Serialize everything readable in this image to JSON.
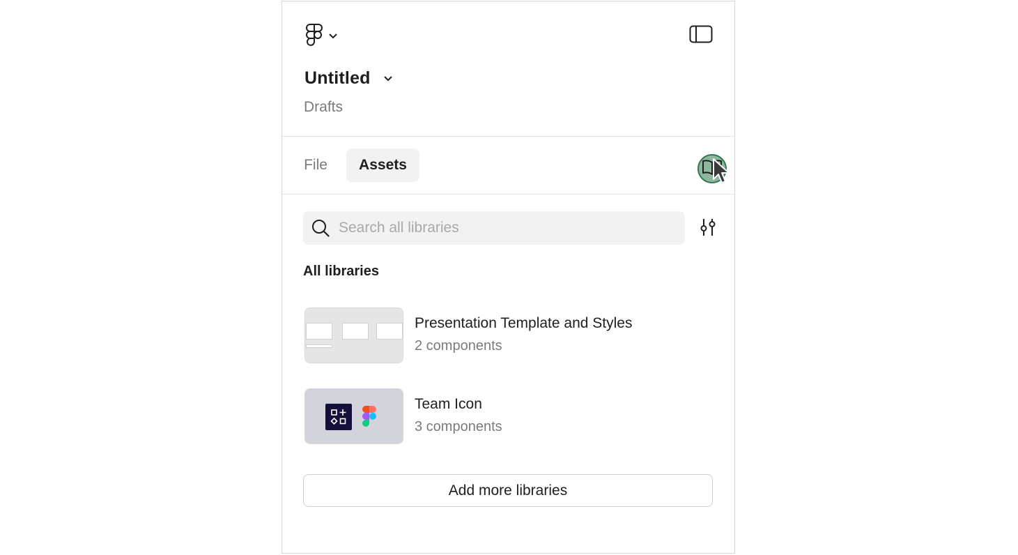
{
  "header": {
    "file_title": "Untitled",
    "file_location": "Drafts"
  },
  "tabs": [
    {
      "label": "File",
      "active": false
    },
    {
      "label": "Assets",
      "active": true
    }
  ],
  "search": {
    "placeholder": "Search all libraries",
    "value": ""
  },
  "libraries": {
    "heading": "All libraries",
    "items": [
      {
        "name": "Presentation Template and Styles",
        "count": "2 components"
      },
      {
        "name": "Team Icon",
        "count": "3 components"
      }
    ],
    "add_label": "Add more libraries"
  },
  "icons": {
    "main_menu": "figma-logo-icon",
    "sidebar_toggle": "sidebar-panel-icon",
    "library": "book-open-icon",
    "search": "search-icon",
    "filter": "sliders-icon"
  },
  "colors": {
    "library_button_fill": "#8fb79f",
    "library_button_border": "#2f7a52",
    "team_icon_tile": "#14103a"
  }
}
